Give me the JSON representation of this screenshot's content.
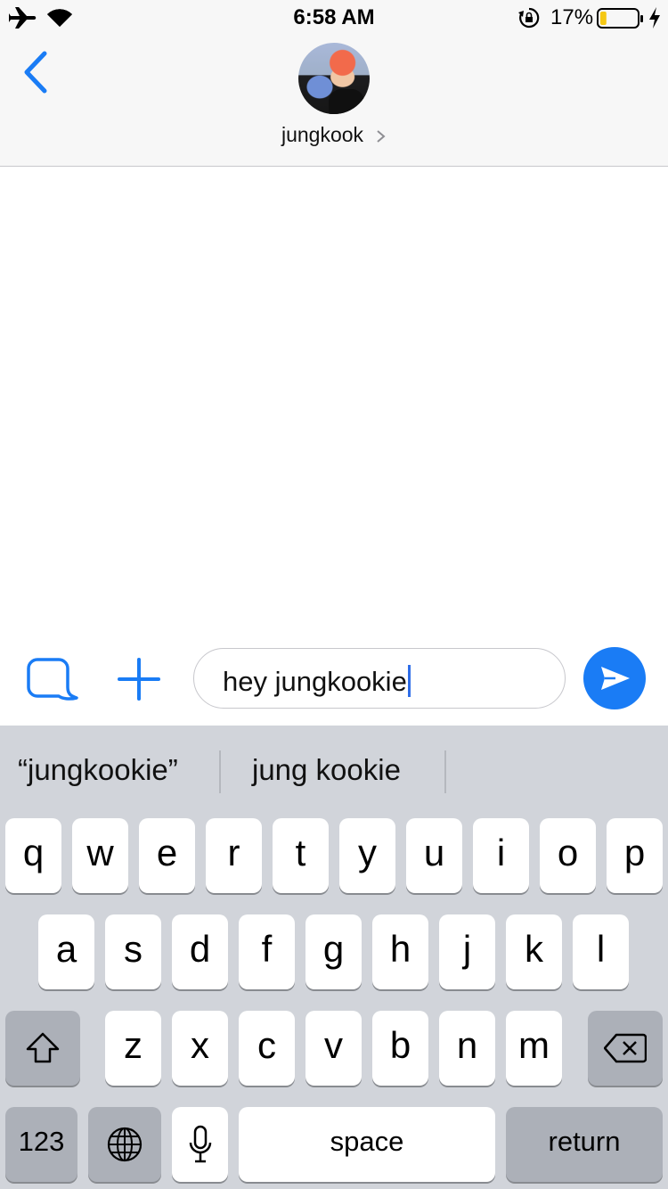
{
  "status_bar": {
    "time": "6:58 AM",
    "battery_percent": "17%",
    "battery_level": 0.17,
    "battery_fill_color": "#f5c814",
    "icons": [
      "airplane-icon",
      "wifi-icon",
      "rotation-lock-icon",
      "battery-icon",
      "charging-bolt-icon"
    ]
  },
  "header": {
    "contact_name": "jungkook",
    "avatar_icon": "contact-avatar",
    "back_icon": "chevron-left-icon",
    "detail_icon": "chevron-right-icon"
  },
  "composer": {
    "text": "hey jungkookie",
    "camera_icon": "camera-bubble-icon",
    "add_icon": "plus-icon",
    "send_icon": "send-arrow-icon",
    "accent_color": "#1a7cf5"
  },
  "keyboard": {
    "suggestions": [
      "“jungkookie”",
      "jung kookie"
    ],
    "row1": [
      "q",
      "w",
      "e",
      "r",
      "t",
      "y",
      "u",
      "i",
      "o",
      "p"
    ],
    "row2": [
      "a",
      "s",
      "d",
      "f",
      "g",
      "h",
      "j",
      "k",
      "l"
    ],
    "row3": [
      "z",
      "x",
      "c",
      "v",
      "b",
      "n",
      "m"
    ],
    "numbers_label": "123",
    "space_label": "space",
    "return_label": "return",
    "shift_icon": "shift-arrow-icon",
    "delete_icon": "backspace-icon",
    "globe_icon": "globe-icon",
    "mic_icon": "microphone-icon"
  }
}
